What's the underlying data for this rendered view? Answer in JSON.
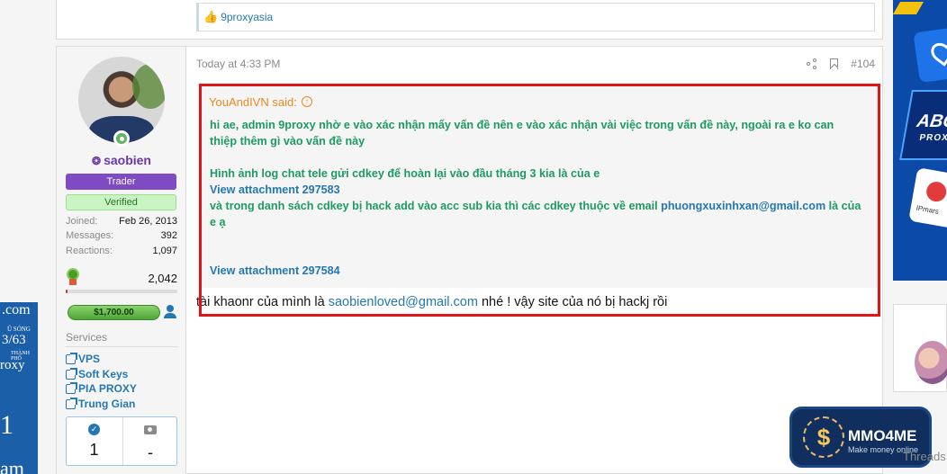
{
  "left_ad": {
    "l1": ".com",
    "l2": "Ũ SÓNG",
    "l3": "3/63",
    "l4": "THÀNH PHỐ",
    "l5": "roxy",
    "l6": "1",
    "l7": "am"
  },
  "prev_post": {
    "reaction_user": "9proxyasia",
    "reaction_icon": "thumbs-up-icon"
  },
  "post": {
    "time": "Today at 4:33 PM",
    "number": "#104",
    "user": {
      "name": "saobien",
      "title_badge": "Trader",
      "verified_badge": "Verified",
      "joined_label": "Joined:",
      "joined": "Feb 26, 2013",
      "messages_label": "Messages:",
      "messages": "392",
      "reactions_label": "Reactions:",
      "reactions": "1,097",
      "points": "2,042",
      "points_progress": 0.02,
      "balance": "$1,700.00",
      "services_title": "Services",
      "services": [
        "VPS",
        "Soft Keys",
        "PIA PROXY",
        "Trung Gian"
      ],
      "trust_left": "1",
      "trust_right": "-"
    },
    "quote": {
      "author": "YouAndIVN said:",
      "line1": "hi ae, admin 9proxy nhờ e vào xác nhận mấy vấn đề nên e vào xác nhận vài việc trong vấn đề này, ngoài ra e ko can",
      "line2": "thiệp thêm gì vào vấn đề này",
      "line3": "Hình ảnh log chat tele gửi cdkey để hoàn lại vào đầu tháng 3 kia là của e",
      "link1": "View attachment 297583",
      "line4_pre": "và trong danh sách cdkey bị hack add vào acc sub kia thì các cdkey thuộc về email ",
      "line4_email": "phuongxuxinhxan@gmail.com",
      "line4_post": " là của",
      "line5": "e ạ",
      "link2": "View attachment 297584"
    },
    "reply": {
      "pre": "tài khaonr của mình là ",
      "email": "saobienloved@gmail.com",
      "post": " nhé ! vậy site của nó bị hackj rồi"
    }
  },
  "right_ad": {
    "abc": "ABC",
    "proxy": "PROXY",
    "ipmars": "IPmars"
  },
  "widget": {
    "title": "MMO4ME",
    "subtitle": "Make money online",
    "logo": "$"
  },
  "threads_label": "Threads"
}
